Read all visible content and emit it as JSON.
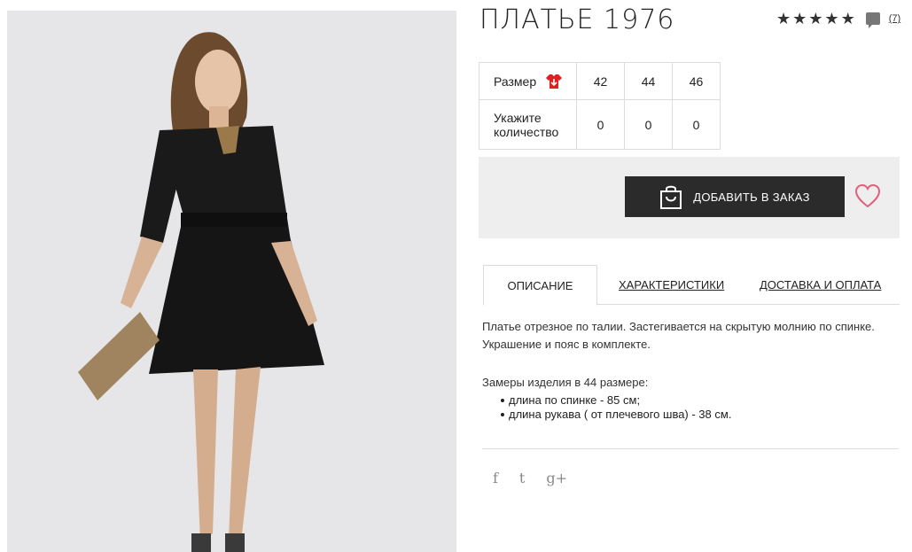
{
  "product": {
    "title": "ПЛАТЬЕ 1976",
    "stars": [
      "★",
      "★",
      "★",
      "★",
      "★"
    ],
    "review_count": "(7)"
  },
  "size_table": {
    "size_label": "Размер",
    "qty_label": "Укажите количество",
    "sizes": [
      "42",
      "44",
      "46"
    ],
    "quantities": [
      "0",
      "0",
      "0"
    ]
  },
  "order": {
    "add_button_label": "ДОБАВИТЬ В ЗАКАЗ"
  },
  "tabs": {
    "description": "ОПИСАНИЕ",
    "characteristics": "ХАРАКТЕРИСТИКИ",
    "delivery": "ДОСТАВКА И ОПЛАТА"
  },
  "description": {
    "line1": "Платье отрезное по талии. Застегивается на скрытую молнию по спинке.",
    "line2": "Украшение и пояс в комплекте.",
    "measurements_title": "Замеры изделия в 44 размере:",
    "measurements": [
      "длина по спинке - 85 см;",
      "длина рукава ( от плечевого шва) - 38 см."
    ]
  },
  "social": {
    "facebook": "f",
    "twitter": "t",
    "google_plus": "g+"
  },
  "colors": {
    "button_bg": "#2b2b2b",
    "heart": "#e0607e",
    "size_icon": "#e02020",
    "photo_bg": "#e6e6e8"
  }
}
